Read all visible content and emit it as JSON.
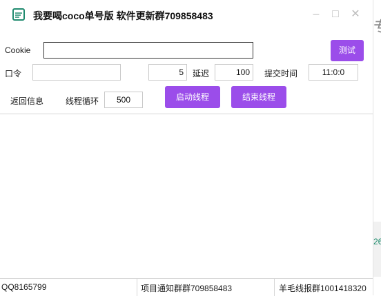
{
  "window": {
    "title": "我要喝coco单号版 软件更新群709858483",
    "minimize": "–",
    "maximize": "□",
    "close": "✕"
  },
  "form": {
    "cookie_label": "Cookie",
    "cookie_value": "",
    "test_button": "测试",
    "code_label": "口令",
    "code_value": "",
    "threads_value": "5",
    "delay_label": "延迟",
    "delay_value": "100",
    "submit_time_label": "提交时间",
    "submit_time_value": "11:0:0",
    "return_info_label": "返回信息",
    "thread_loop_label": "线程循环",
    "thread_loop_value": "500",
    "start_button": "启动线程",
    "stop_button": "结束线程"
  },
  "statusbar": {
    "qq": "QQ8165799",
    "notify_group": "项目通知群群709858483",
    "report_group": "羊毛线报群1001418320"
  },
  "background": {
    "glyph": "专",
    "number": "26"
  },
  "colors": {
    "accent": "#9b4dea",
    "icon_green": "#1f8a6e"
  }
}
